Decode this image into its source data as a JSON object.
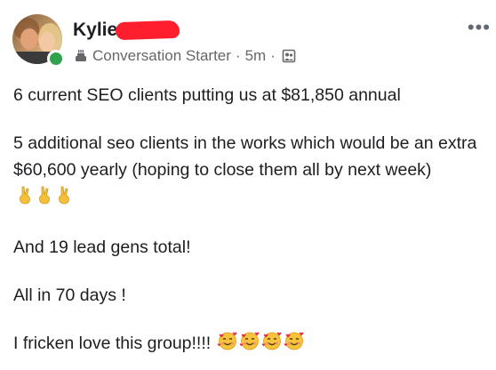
{
  "post": {
    "author": {
      "name": "Kylie",
      "badge_icon": "conversation-starter-badge-icon",
      "badge_label": "Conversation Starter",
      "timestamp": "5m",
      "separator": "·",
      "audience_icon": "group-icon",
      "online_status_color": "#31a24c"
    },
    "more_options_icon": "more-options-icon",
    "more_options_glyph": "•••",
    "body": {
      "line1": "6 current SEO clients putting us at $81,850 annual",
      "line2": "5 additional seo clients in the works which would be an extra $60,600 yearly (hoping to close them all by next week)",
      "line2_emoji": "crossed-fingers-icon x3",
      "line3": "And 19 lead gens total!",
      "line4": "All in 70 days !",
      "line5": "I fricken love this group!!!!",
      "line5_emoji": "smiling-face-with-hearts-icon x4"
    },
    "redaction_color": "#ff1e2d"
  }
}
